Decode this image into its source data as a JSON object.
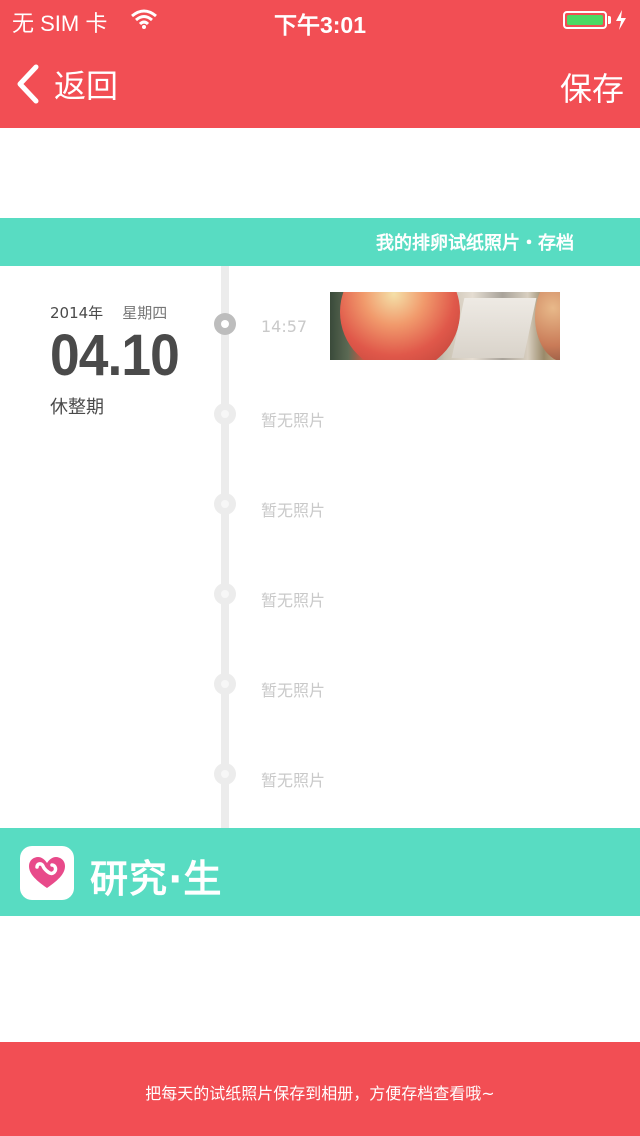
{
  "status_bar": {
    "carrier": "无 SIM 卡",
    "time": "下午3:01",
    "battery_level": 1.0
  },
  "nav": {
    "back_label": "返回",
    "save_label": "保存"
  },
  "card": {
    "title": "我的排卵试纸照片・存档",
    "date": {
      "year": "2014年",
      "weekday": "星期四",
      "day": "04.10",
      "phase": "休整期"
    },
    "entries": [
      {
        "label": "14:57"
      },
      {
        "label": "暂无照片"
      },
      {
        "label": "暂无照片"
      },
      {
        "label": "暂无照片"
      },
      {
        "label": "暂无照片"
      },
      {
        "label": "暂无照片"
      }
    ],
    "brand": "研究·生"
  },
  "footer": {
    "message": "把每天的试纸照片保存到相册，方便存档查看哦~"
  },
  "colors": {
    "primary_red": "#f24e54",
    "teal": "#58dcc2",
    "timeline_gray": "#ececec"
  }
}
